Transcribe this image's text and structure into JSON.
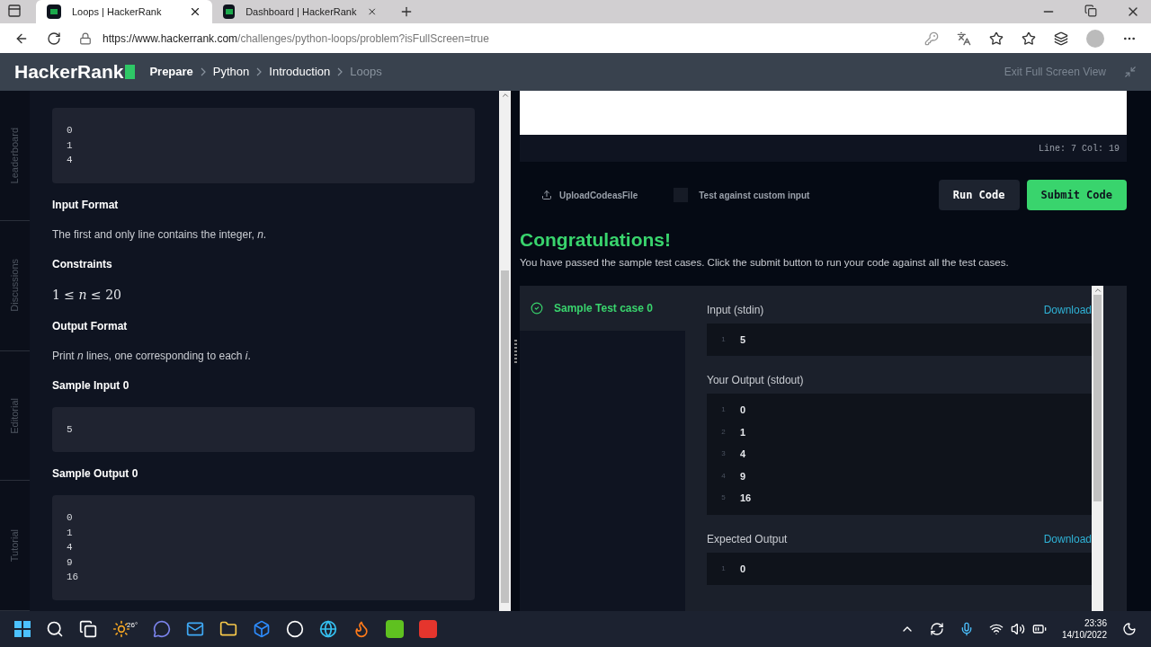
{
  "browser": {
    "tabs": [
      {
        "title": "Loops | HackerRank",
        "selected": true
      },
      {
        "title": "Dashboard | HackerRank",
        "selected": false
      }
    ],
    "url_host": "https://www.hackerrank.com",
    "url_path": "/challenges/python-loops/problem?isFullScreen=true"
  },
  "header": {
    "logo": "HackerRank",
    "breadcrumbs": [
      {
        "label": "Prepare",
        "current": false
      },
      {
        "label": "Python",
        "current": false
      },
      {
        "label": "Introduction",
        "current": false
      },
      {
        "label": "Loops",
        "current": true
      }
    ],
    "exit": "Exit Full Screen View"
  },
  "side_tabs": [
    "Leaderboard",
    "Discussions",
    "Editorial",
    "Tutorial"
  ],
  "problem": [
    {
      "kind": "code",
      "lines": [
        "0",
        "1",
        "4"
      ]
    },
    {
      "kind": "heading",
      "text": "Input Format"
    },
    {
      "kind": "text",
      "text": "The first and only line contains the integer, *n*."
    },
    {
      "kind": "heading",
      "text": "Constraints"
    },
    {
      "kind": "math",
      "text": "1 ≤ *n* ≤ 20"
    },
    {
      "kind": "heading",
      "text": "Output Format"
    },
    {
      "kind": "text",
      "text": "Print *n* lines, one corresponding to each *i*."
    },
    {
      "kind": "heading",
      "text": "Sample Input 0"
    },
    {
      "kind": "code",
      "lines": [
        "5"
      ]
    },
    {
      "kind": "heading",
      "text": "Sample Output 0"
    },
    {
      "kind": "code",
      "lines": [
        "0",
        "1",
        "4",
        "9",
        "16"
      ]
    }
  ],
  "editor": {
    "cursor": "Line: 7 Col: 19",
    "upload": "UploadCodeasFile",
    "custom_input": {
      "label": "Test against custom input",
      "checked": false
    },
    "run": "Run Code",
    "submit": "Submit Code"
  },
  "result": {
    "title": "Congratulations!",
    "message": "You have passed the sample test cases. Click the submit button to run your code against all the test cases."
  },
  "test_cases": [
    {
      "name": "Sample Test case 0",
      "passed": true,
      "selected": true
    }
  ],
  "details": [
    {
      "title": "Input (stdin)",
      "download": "Download",
      "lines": [
        {
          "no": "1",
          "text": "5"
        }
      ]
    },
    {
      "title": "Your Output (stdout)",
      "lines": [
        {
          "no": "1",
          "text": "0"
        },
        {
          "no": "2",
          "text": "1"
        },
        {
          "no": "3",
          "text": "4"
        },
        {
          "no": "4",
          "text": "9"
        },
        {
          "no": "5",
          "text": "16"
        }
      ]
    },
    {
      "title": "Expected Output",
      "download": "Download",
      "lines": [
        {
          "no": "1",
          "text": "0"
        }
      ]
    }
  ],
  "taskbar": {
    "weather": "26°",
    "time": "23:36",
    "date": "14/10/2022"
  }
}
